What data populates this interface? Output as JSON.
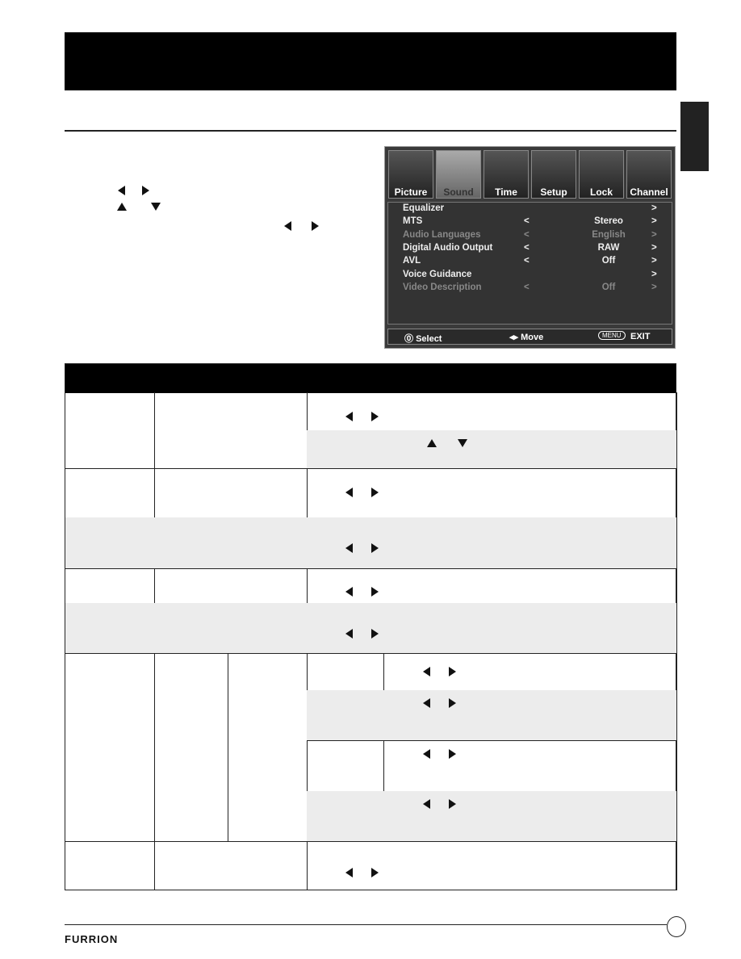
{
  "osd": {
    "tabs": [
      "Picture",
      "Sound",
      "Time",
      "Setup",
      "Lock",
      "Channel"
    ],
    "selected_tab": "Sound",
    "items": [
      {
        "label": "Equalizer",
        "value": "",
        "left_arrow": false,
        "enabled": true
      },
      {
        "label": "MTS",
        "value": "Stereo",
        "left_arrow": true,
        "enabled": true
      },
      {
        "label": "Audio Languages",
        "value": "English",
        "left_arrow": true,
        "enabled": false
      },
      {
        "label": "Digital Audio Output",
        "value": "RAW",
        "left_arrow": true,
        "enabled": true
      },
      {
        "label": "AVL",
        "value": "Off",
        "left_arrow": true,
        "enabled": true
      },
      {
        "label": "Voice Guidance",
        "value": "",
        "left_arrow": false,
        "enabled": true
      },
      {
        "label": "Video Description",
        "value": "Off",
        "left_arrow": true,
        "enabled": false
      }
    ],
    "footer": {
      "select": "Select",
      "move": "Move",
      "menu": "MENU",
      "exit": "EXIT"
    },
    "left_char": "<",
    "right_char": ">"
  },
  "footer": {
    "brand": "FURRION"
  }
}
